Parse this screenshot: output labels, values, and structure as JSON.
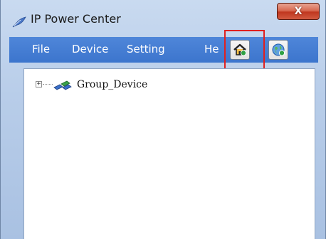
{
  "window": {
    "title": "IP Power Center",
    "close_glyph": "X"
  },
  "menu": {
    "items": [
      "File",
      "Device",
      "Setting",
      "He"
    ]
  },
  "toolbar": {
    "buttons": [
      {
        "icon": "home-device-icon",
        "highlighted": true
      },
      {
        "icon": "globe-device-icon",
        "highlighted": false
      }
    ]
  },
  "tree": {
    "root": {
      "label": "Group_Device",
      "expander": "+",
      "icon": "network-group-icon"
    }
  },
  "colors": {
    "menubar": "#3c75cd",
    "highlight": "#e02020",
    "close": "#c0371f"
  }
}
